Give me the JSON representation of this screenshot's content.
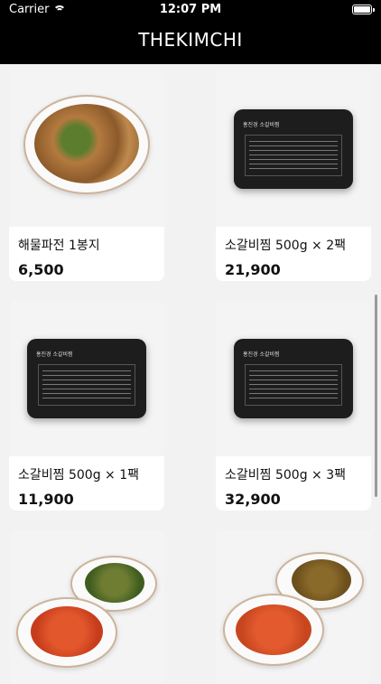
{
  "status_bar": {
    "carrier": "Carrier",
    "time": "12:07 PM"
  },
  "header": {
    "title": "THEKIMCHI"
  },
  "products": [
    {
      "name": "해물파전 1봉지",
      "price": "6,500",
      "image": "seafood-pancake"
    },
    {
      "name": "소갈비찜 500g × 2팩",
      "price": "21,900",
      "image": "black-pack"
    },
    {
      "name": "소갈비찜 500g × 1팩",
      "price": "11,900",
      "image": "black-pack"
    },
    {
      "name": "소갈비찜 500g × 3팩",
      "price": "32,900",
      "image": "black-pack"
    },
    {
      "name": "",
      "price": "",
      "image": "kimchi-plates"
    },
    {
      "name": "",
      "price": "",
      "image": "kimchi-plates"
    }
  ],
  "pack_label": "홍진경 소갈비찜"
}
